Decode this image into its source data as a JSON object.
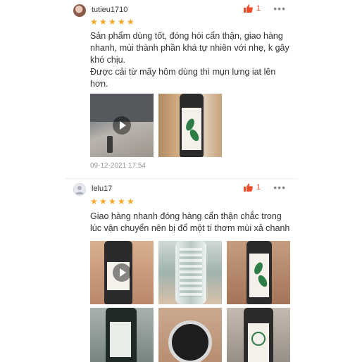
{
  "reviews": [
    {
      "username": "tutieu1710",
      "likes": "1",
      "more": "•••",
      "rating": 5,
      "comment_lines": [
        "Sản phẩm dùng tốt, đóng hói cẩn thận, giao hàng nhanh, mùi thành phần khá tự nhiên với nhẹ, k gây khó chịu.",
        "Được cải từ mấy hôm dùng thì mụn lưng iat lên hơn."
      ],
      "timestamp": "09-12-2021 17:54"
    },
    {
      "username": "lelu17",
      "likes": "1",
      "more": "•••",
      "rating": 5,
      "comment_lines": [
        "Giao hàng nhanh đóng hàng cẩn thận chắc trong lúc vận chuyển nên bị đổ một tí thơm mùi xả chanh"
      ]
    }
  ],
  "colors": {
    "accent": "#ee4d2d",
    "star": "#f5a623",
    "timestamp": "#999999"
  },
  "icons": [
    "thumbs-up-icon",
    "more-icon",
    "star-icon",
    "play-icon",
    "user-icon"
  ]
}
